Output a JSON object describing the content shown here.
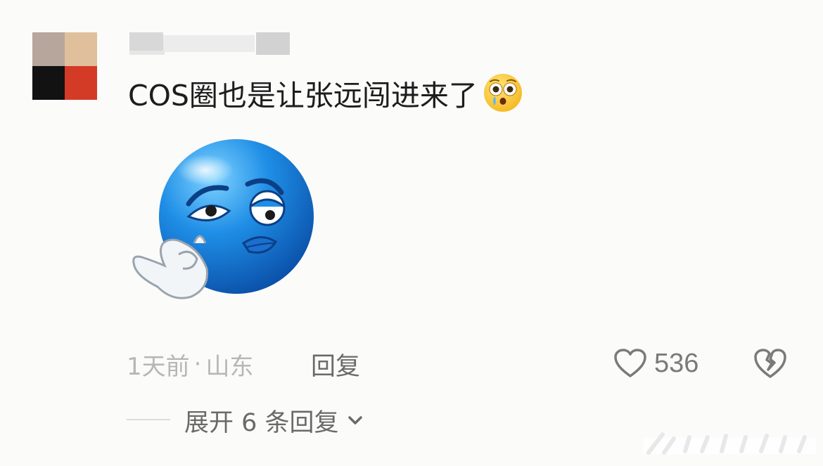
{
  "comment": {
    "text": "COS圈也是让张远闯进来了",
    "inline_emoji": "flushed-face-emoji",
    "sticker": "blue-face-ok-hand-sticker",
    "meta": {
      "time": "1天前",
      "separator": "·",
      "location": "山东"
    },
    "reply_label": "回复",
    "like_count": "536",
    "expand_label": "展开 6 条回复"
  },
  "avatar": {
    "colors": [
      "#b7a69b",
      "#e0c09c",
      "#121212",
      "#d43b27"
    ]
  },
  "icons": {
    "like": "heart-outline-icon",
    "dislike": "broken-heart-icon",
    "expand": "chevron-down-icon"
  },
  "colors": {
    "background": "#fbfbfa",
    "text_primary": "#1d1d1d",
    "text_meta": "#b7b7b7",
    "text_action": "#6a6a6a"
  }
}
